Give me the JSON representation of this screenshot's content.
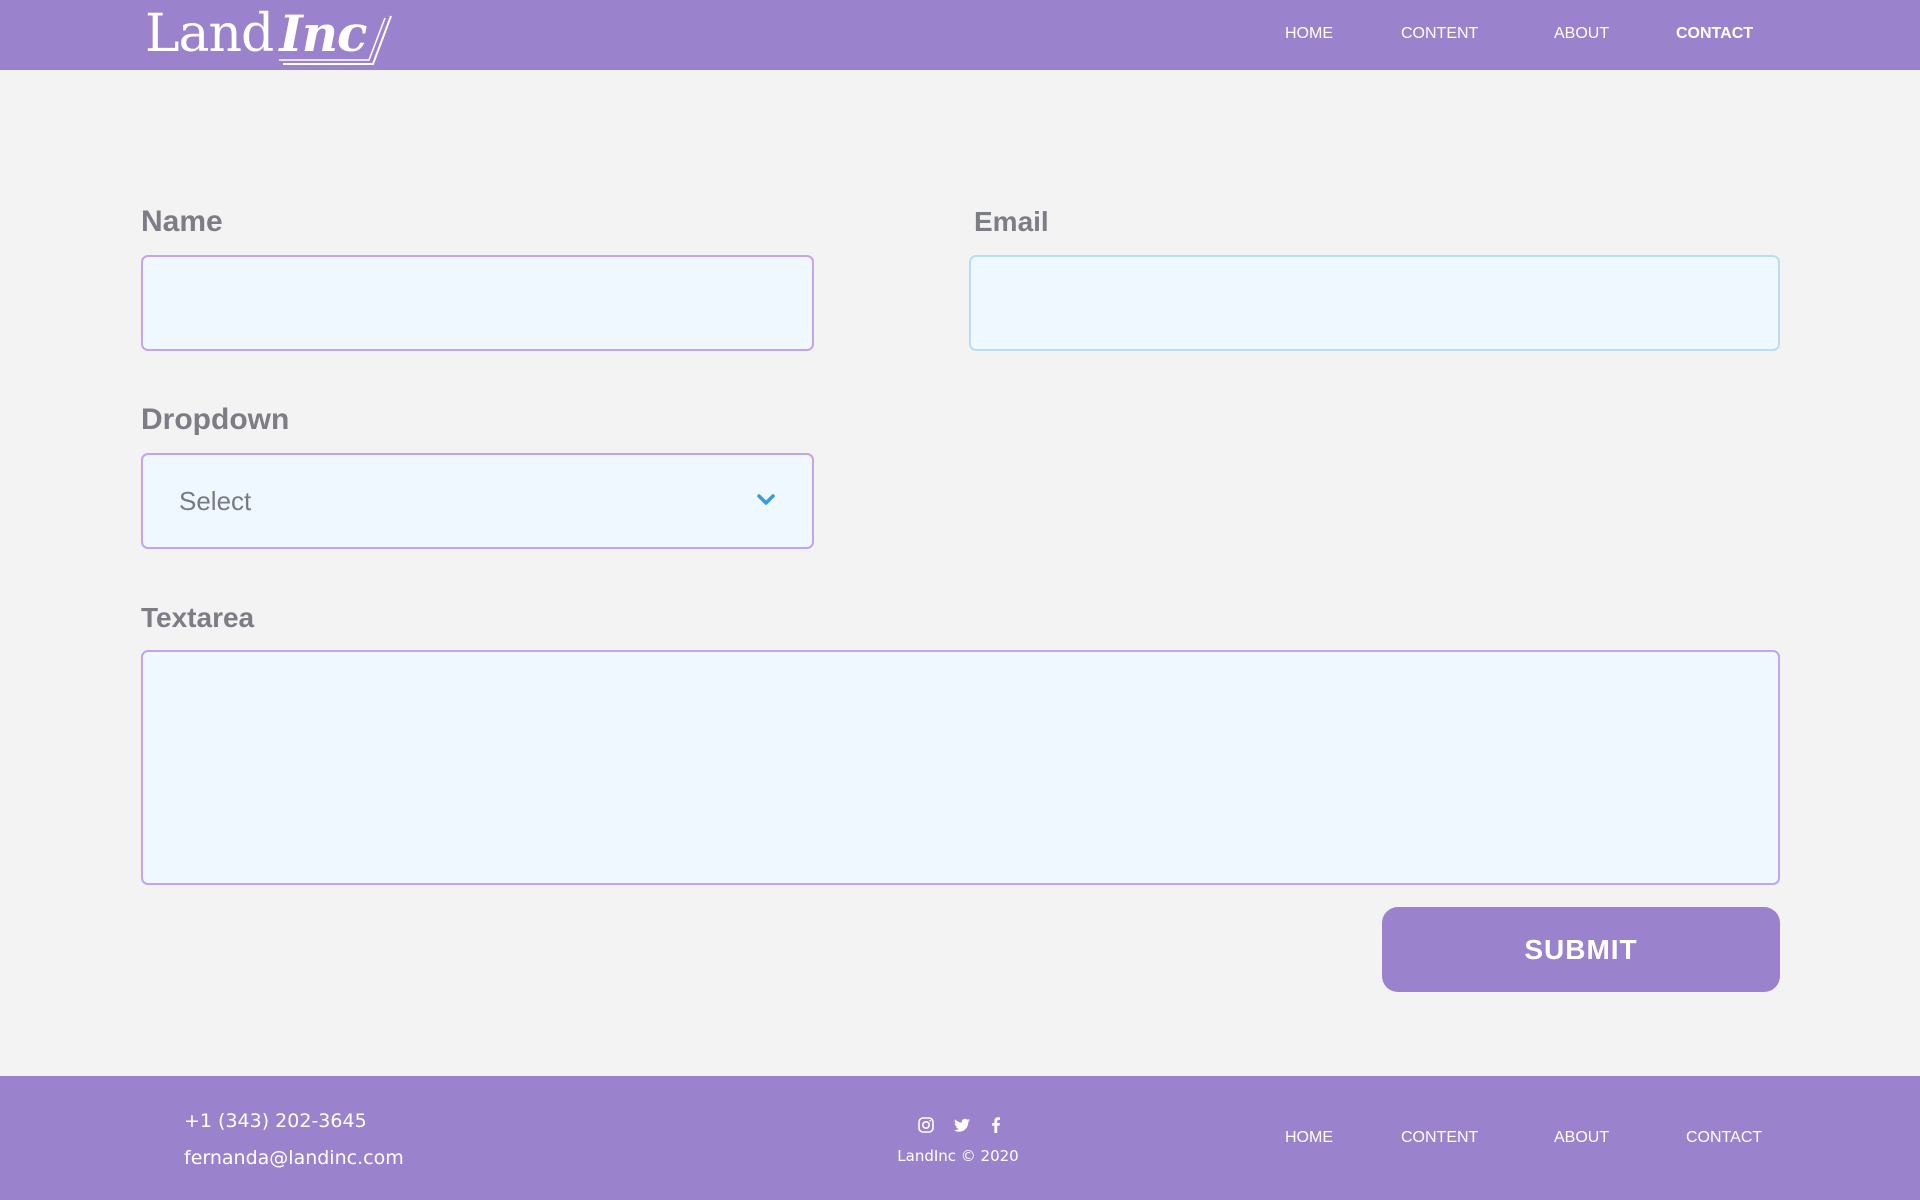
{
  "brand": {
    "logo_text_1": "Land",
    "logo_text_2": "Inc",
    "color": "#9b82cd"
  },
  "header": {
    "nav": [
      {
        "label": "HOME",
        "active": false
      },
      {
        "label": "CONTENT",
        "active": false
      },
      {
        "label": "ABOUT",
        "active": false
      },
      {
        "label": "CONTACT",
        "active": true
      }
    ]
  },
  "form": {
    "name": {
      "label": "Name",
      "value": ""
    },
    "email": {
      "label": "Email",
      "value": ""
    },
    "dropdown": {
      "label": "Dropdown",
      "selected": "Select"
    },
    "textarea": {
      "label": "Textarea",
      "value": ""
    },
    "submit_label": "SUBMIT"
  },
  "footer": {
    "phone": "+1 (343) 202-3645",
    "email": "fernanda@landinc.com",
    "socials": [
      "instagram-icon",
      "twitter-icon",
      "facebook-icon"
    ],
    "copyright": "LandInc © 2020",
    "nav": [
      {
        "label": "HOME"
      },
      {
        "label": "CONTENT"
      },
      {
        "label": "ABOUT"
      },
      {
        "label": "CONTACT"
      }
    ]
  }
}
